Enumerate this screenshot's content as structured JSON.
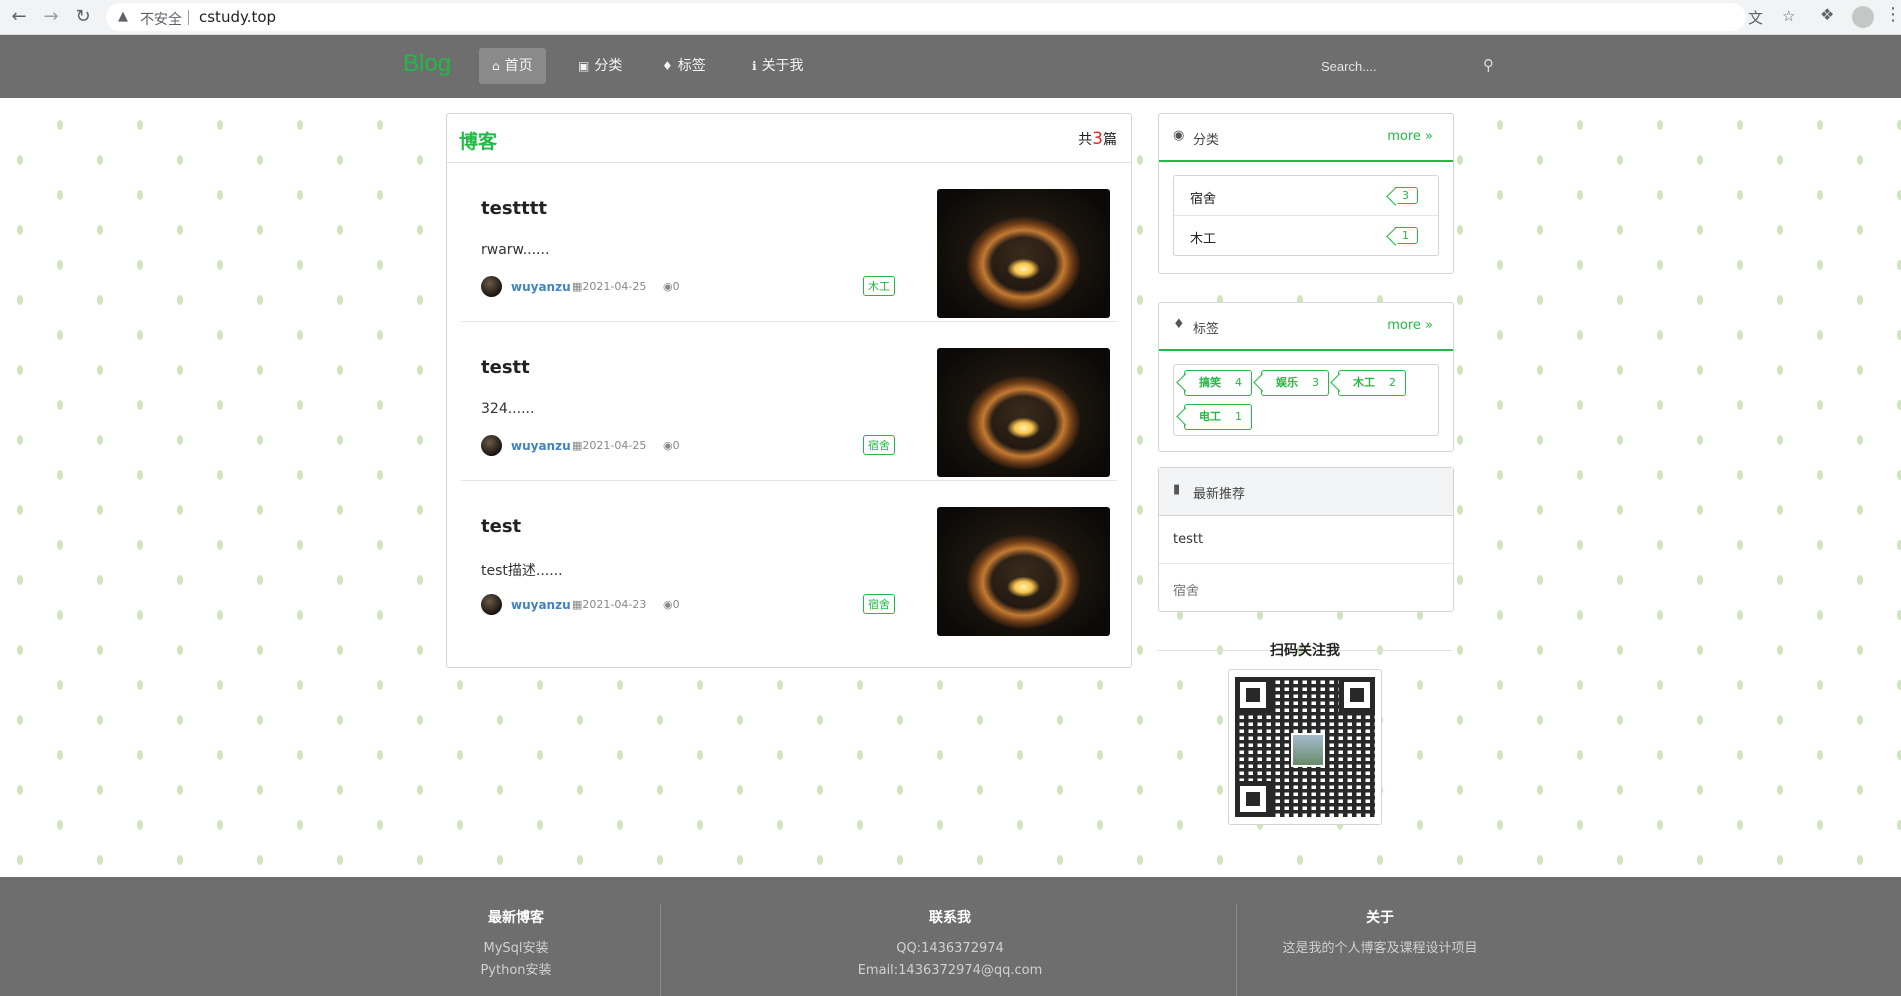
{
  "browser": {
    "security_label": "不安全",
    "url": "cstudy.top"
  },
  "navbar": {
    "brand": "Blog",
    "items": [
      {
        "label": "首页",
        "icon": "home-icon",
        "active": true
      },
      {
        "label": "分类",
        "icon": "sitemap-icon",
        "active": false
      },
      {
        "label": "标签",
        "icon": "tags-icon",
        "active": false
      },
      {
        "label": "关于我",
        "icon": "info-icon",
        "active": false
      }
    ],
    "search_placeholder": "Search...."
  },
  "blog": {
    "title": "博客",
    "count_prefix": "共",
    "count": "3",
    "count_suffix": "篇",
    "posts": [
      {
        "title": "testttt",
        "desc": "rwarw......",
        "author": "wuyanzu",
        "date": "2021-04-25",
        "views": "0",
        "tag": "木工"
      },
      {
        "title": "testt",
        "desc": "324......",
        "author": "wuyanzu",
        "date": "2021-04-25",
        "views": "0",
        "tag": "宿舍"
      },
      {
        "title": "test",
        "desc": "test描述......",
        "author": "wuyanzu",
        "date": "2021-04-23",
        "views": "0",
        "tag": "宿舍"
      }
    ]
  },
  "sidebar": {
    "categories": {
      "title": "分类",
      "more": "more",
      "items": [
        {
          "name": "宿舍",
          "count": "3"
        },
        {
          "name": "木工",
          "count": "1"
        }
      ]
    },
    "tags": {
      "title": "标签",
      "more": "more",
      "items": [
        {
          "name": "搞笑",
          "count": "4"
        },
        {
          "name": "娱乐",
          "count": "3"
        },
        {
          "name": "木工",
          "count": "2"
        },
        {
          "name": "电工",
          "count": "1"
        }
      ]
    },
    "recommend": {
      "title": "最新推荐",
      "items": [
        "testt",
        "宿舍"
      ]
    },
    "qr_title": "扫码关注我"
  },
  "footer": {
    "latest": {
      "title": "最新博客",
      "lines": [
        "MySql安装",
        "Python安装"
      ]
    },
    "contact": {
      "title": "联系我",
      "lines": [
        "QQ:1436372974",
        "Email:1436372974@qq.com"
      ]
    },
    "about": {
      "title": "关于",
      "lines": [
        "这是我的个人博客及课程设计项目"
      ]
    }
  },
  "colors": {
    "accent": "#21ba45",
    "nav_bg": "#6e6e6e",
    "count_red": "#db2828",
    "link_blue": "#4183c4"
  }
}
